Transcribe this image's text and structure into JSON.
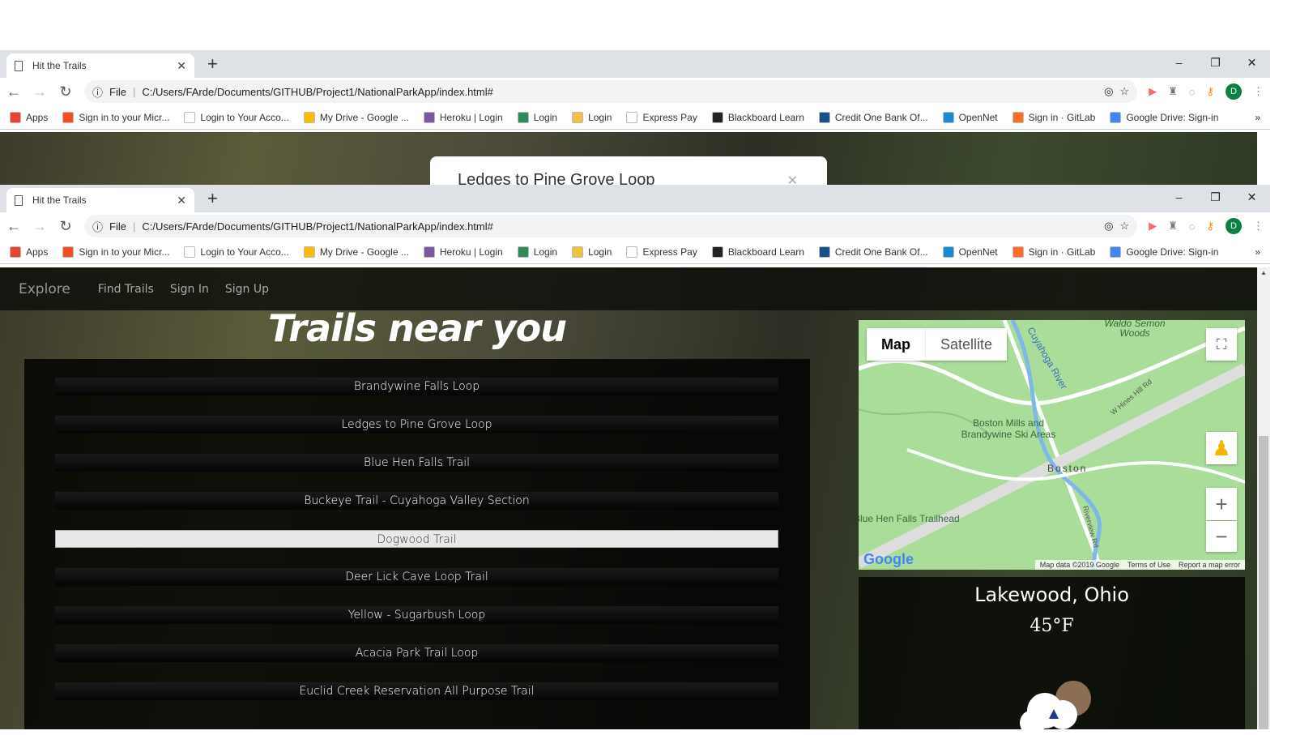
{
  "browser": {
    "tab_title": "Hit the Trails",
    "url_prefix": "File",
    "url": "C:/Users/FArde/Documents/GITHUB/Project1/NationalParkApp/index.html#",
    "avatar": "D",
    "bookmarks": [
      {
        "label": "Apps",
        "color": "#e94235"
      },
      {
        "label": "Sign in to your Micr...",
        "color": "#f25022"
      },
      {
        "label": "Login to Your Acco...",
        "color": "#ffffff"
      },
      {
        "label": "My Drive - Google ...",
        "color": "#fbbc04"
      },
      {
        "label": "Heroku | Login",
        "color": "#79589f"
      },
      {
        "label": "Login",
        "color": "#2e8b57"
      },
      {
        "label": "Login",
        "color": "#f0c040"
      },
      {
        "label": "Express Pay",
        "color": "#ffffff"
      },
      {
        "label": "Blackboard Learn",
        "color": "#222222"
      },
      {
        "label": "Credit One Bank Of...",
        "color": "#1a4f8a"
      },
      {
        "label": "OpenNet",
        "color": "#1a8ad4"
      },
      {
        "label": "Sign in · GitLab",
        "color": "#fc6d26"
      },
      {
        "label": "Google Drive: Sign-in",
        "color": "#4285f4"
      }
    ]
  },
  "modal": {
    "title": "Ledges to Pine Grove Loop"
  },
  "nav": {
    "brand": "Explore",
    "links": [
      "Find Trails",
      "Sign In",
      "Sign Up"
    ]
  },
  "heading": "Trails near you",
  "trails": [
    {
      "name": "Brandywine Falls Loop"
    },
    {
      "name": "Ledges to Pine Grove Loop"
    },
    {
      "name": "Blue Hen Falls Trail"
    },
    {
      "name": "Buckeye Trail - Cuyahoga Valley Section"
    },
    {
      "name": "Dogwood Trail",
      "selected": true
    },
    {
      "name": "Deer Lick Cave Loop Trail"
    },
    {
      "name": "Yellow - Sugarbush Loop"
    },
    {
      "name": "Acacia Park Trail Loop"
    },
    {
      "name": "Euclid Creek Reservation All Purpose Trail"
    }
  ],
  "map": {
    "type_map": "Map",
    "type_satellite": "Satellite",
    "labels": [
      "Waldo Semon Woods",
      "Cuyahoga River",
      "Boston Mills and Brandywine Ski Areas",
      "Boston",
      "Blue Hen Falls Trailhead",
      "W Hines Hill Rd",
      "Riverview Rd"
    ],
    "logo": "Google",
    "footer": [
      "Map data ©2019 Google",
      "Terms of Use",
      "Report a map error"
    ]
  },
  "weather": {
    "city": "Lakewood, Ohio",
    "temp": "45°F",
    "icon": "cloud-rain-sun-icon"
  }
}
